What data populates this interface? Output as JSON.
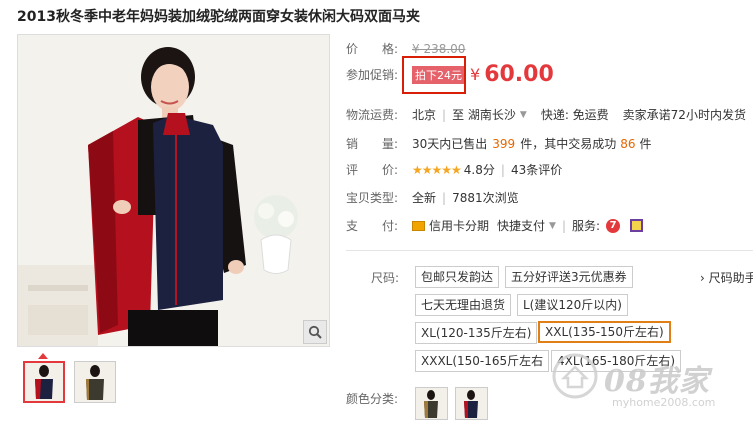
{
  "product": {
    "title": "2013秋冬季中老年妈妈装加绒驼绒两面穿女装休闲大码双面马夹"
  },
  "price": {
    "label": "价　　格:",
    "original": "¥ 238.00"
  },
  "promo": {
    "label": "参加促销:",
    "tag": "拍下24元",
    "currency": "¥",
    "price": "60.00"
  },
  "logistics": {
    "label": "物流运费:",
    "origin": "北京",
    "destination": "至  湖南长沙",
    "shipping": "快递: 免运费",
    "promise": "卖家承诺72小时内发货"
  },
  "sales": {
    "label": "销　　量:",
    "prefix": "30天内已售出",
    "sold": "399",
    "middle": "件，其中交易成功",
    "success": "86",
    "suffix": "件"
  },
  "rating": {
    "label": "评　　价:",
    "stars": "★★★★★",
    "score": "4.8分",
    "count": "43条评价"
  },
  "item_type": {
    "label": "宝贝类型:",
    "condition": "全新",
    "views": "7881次浏览"
  },
  "payment": {
    "label": "支　　付:",
    "credit": "信用卡分期",
    "quick": "快捷支付",
    "service_label": "服务:"
  },
  "sizes": {
    "label": "尺码:",
    "options": [
      "包邮只发韵达",
      "五分好评送3元优惠券",
      "七天无理由退货",
      "L(建议120斤以内)",
      "XL(120-135斤左右)",
      "XXL(135-150斤左右)",
      "XXXL(150-165斤左右",
      "4XL(165-180斤左右)"
    ],
    "selected": "XXL(135-150斤左右)",
    "help": "› 尺码助手"
  },
  "colors": {
    "label": "颜色分类:"
  },
  "watermark": {
    "brand": "08我家",
    "url": "myhome2008.com"
  },
  "theme": {
    "accent_red": "#e4393c",
    "orange": "#e56600",
    "selected_border": "#e07f18",
    "promo_bg": "#e5626b"
  }
}
